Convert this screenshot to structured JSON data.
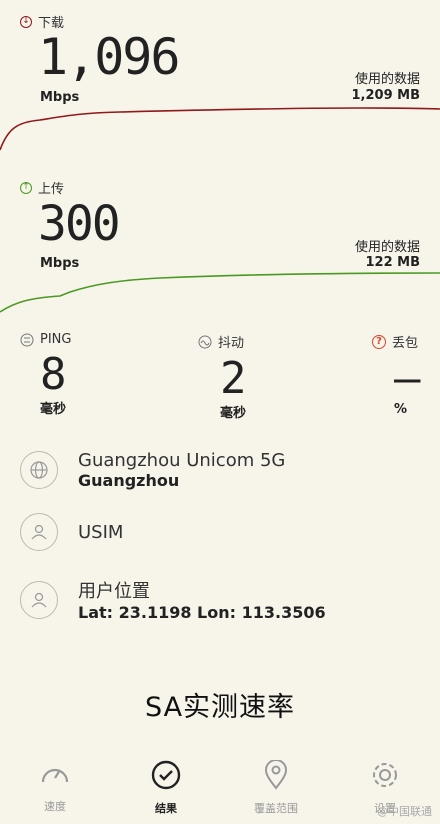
{
  "download": {
    "label": "下载",
    "value": "1,096",
    "unit": "Mbps",
    "data_used_label": "使用的数据",
    "data_used_value": "1,209 MB",
    "color": "#8f1a1a"
  },
  "upload": {
    "label": "上传",
    "value": "300",
    "unit": "Mbps",
    "data_used_label": "使用的数据",
    "data_used_value": "122 MB",
    "color": "#4a9a22"
  },
  "metrics": [
    {
      "label": "PING",
      "value": "8",
      "unit": "毫秒",
      "icon": "ping-icon"
    },
    {
      "label": "抖动",
      "value": "2",
      "unit": "毫秒",
      "icon": "jitter-icon"
    },
    {
      "label": "丢包",
      "value": "–",
      "unit": "%",
      "icon": "question-icon",
      "accent": "#d9452b"
    }
  ],
  "info": {
    "network": {
      "title": "Guangzhou Unicom 5G",
      "subtitle": "Guangzhou",
      "icon": "globe-icon"
    },
    "sim": {
      "title": "USIM",
      "icon": "user-icon"
    },
    "location": {
      "title": "用户位置",
      "subtitle": "Lat: 23.1198 Lon: 113.3506",
      "icon": "user-icon"
    }
  },
  "caption": "SA实测速率",
  "nav": [
    {
      "label": "速度",
      "icon": "speedometer-icon"
    },
    {
      "label": "结果",
      "icon": "check-circle-icon",
      "active": true
    },
    {
      "label": "覆盖范围",
      "icon": "location-pin-icon"
    },
    {
      "label": "设置",
      "icon": "gear-icon"
    }
  ],
  "watermark": "@中国联通"
}
